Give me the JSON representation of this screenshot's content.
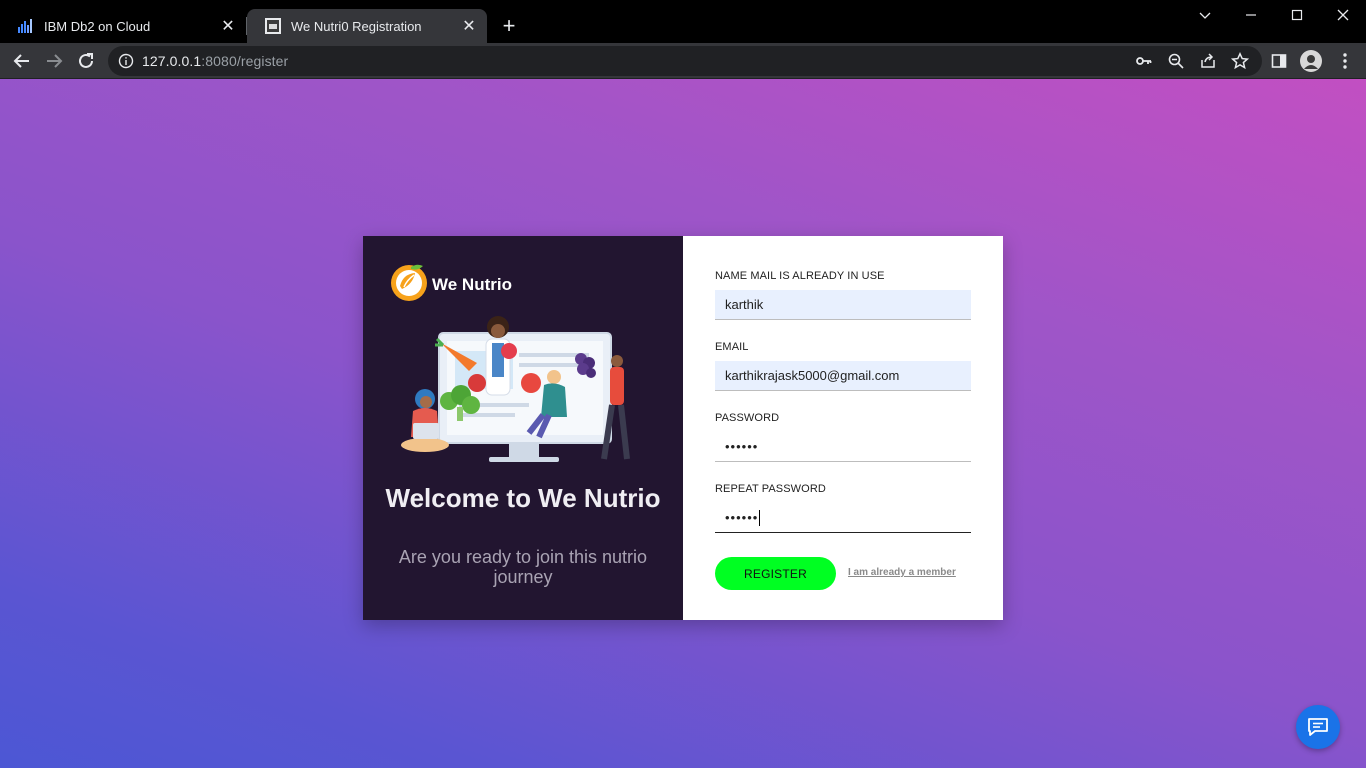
{
  "browser": {
    "tabs": [
      {
        "title": "IBM Db2 on Cloud",
        "icon": "ibm-db2-icon",
        "active": false
      },
      {
        "title": "We Nutri0 Registration",
        "icon": "we-nutrio-favicon",
        "active": true
      }
    ],
    "url_host": "127.0.0.1",
    "url_path": ":8080/register"
  },
  "brand": {
    "name": "We Nutrio"
  },
  "welcome": {
    "title": "Welcome to We Nutrio",
    "subtitle": "Are you ready to join this nutrio journey"
  },
  "form": {
    "name_label": "NAME MAIL IS ALREADY IN USE",
    "name_value": "karthik",
    "email_label": "EMAIL",
    "email_value": "karthikrajask5000@gmail.com",
    "password_label": "PASSWORD",
    "password_value": "••••••",
    "repeat_label": "REPEAT PASSWORD",
    "repeat_value": "••••••",
    "register_label": "REGISTER",
    "member_link": "I am already a member"
  },
  "colors": {
    "register_button": "#00ff22",
    "card_left_bg": "#221530",
    "gradient_top_right": "#c24fc2",
    "gradient_bottom_left": "#4c57d4"
  }
}
